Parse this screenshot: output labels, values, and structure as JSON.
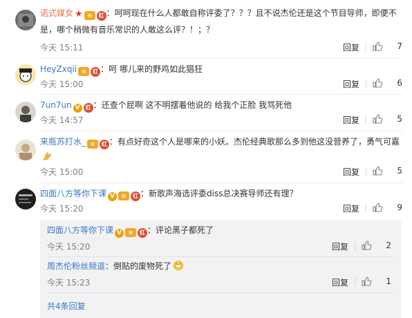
{
  "comments": [
    {
      "username": "诺式媒女",
      "username_color": "#eb7350",
      "badges": [
        "star-icon",
        "level-icon",
        "red-badge-icon"
      ],
      "text": "：呵呵现在什么人都敢自称评委了？？？且不说杰伦还是这个节目导师，即便不是，哪个稍微有音乐常识的人敢这么评？！；？",
      "time": "今天 15:11",
      "reply_label": "回复",
      "likes": "7"
    },
    {
      "username": "HeyZxqii",
      "username_color": "#3a7abf",
      "badges": [
        "level-icon",
        "red-badge-icon"
      ],
      "text": "：呵 哪儿来的野鸡如此猖狂",
      "time": "今天 15:00",
      "reply_label": "回复",
      "likes": "6"
    },
    {
      "username": "7un7un",
      "username_color": "#3a7abf",
      "badges": [
        "v-icon",
        "red-badge-icon"
      ],
      "text": "：还查个屁啊 这不明摆着他说的 给我个正脸 我骂死他",
      "time": "今天 14:57",
      "reply_label": "回复",
      "likes": "5"
    },
    {
      "username": "来瓶苏打水_",
      "username_color": "#3a7abf",
      "badges": [
        "level-icon",
        "red-badge-icon"
      ],
      "text": "：有点好奇这个人是哪来的小妖。杰伦经典歌那么多到他这没营养了，勇气可嘉",
      "emoji": "clap-emoji-icon",
      "time": "今天 15:00",
      "reply_label": "回复",
      "likes": "5"
    },
    {
      "username": "四面八方等你下课",
      "username_color": "#3a7abf",
      "badges": [
        "v-icon",
        "level-icon",
        "red-badge-icon"
      ],
      "text": "：新歌声海选评委diss总决赛导师还有理？",
      "time": "今天 15:20",
      "reply_label": "回复",
      "likes": "9"
    }
  ],
  "replies": [
    {
      "username": "四面八方等你下课",
      "badges": [
        "v-icon",
        "level-icon",
        "red-badge-icon"
      ],
      "text": "：评论黑子都死了",
      "time": "今天 15:20",
      "reply_label": "回复",
      "likes": "2"
    },
    {
      "username": "周杰伦粉丝频道",
      "badges": [],
      "text": "：倒贴的废物死了",
      "emoji": "grin-emoji-icon",
      "time": "今天 15:23",
      "reply_label": "回复",
      "likes": "1"
    }
  ],
  "total_replies_link": "共4条回复",
  "badge_glyphs": {
    "v": "V",
    "level": "≡",
    "red": "红"
  },
  "colors": {
    "link": "#3a7abf",
    "accent": "#eb7350",
    "sub_bg": "#f2f2f5"
  }
}
